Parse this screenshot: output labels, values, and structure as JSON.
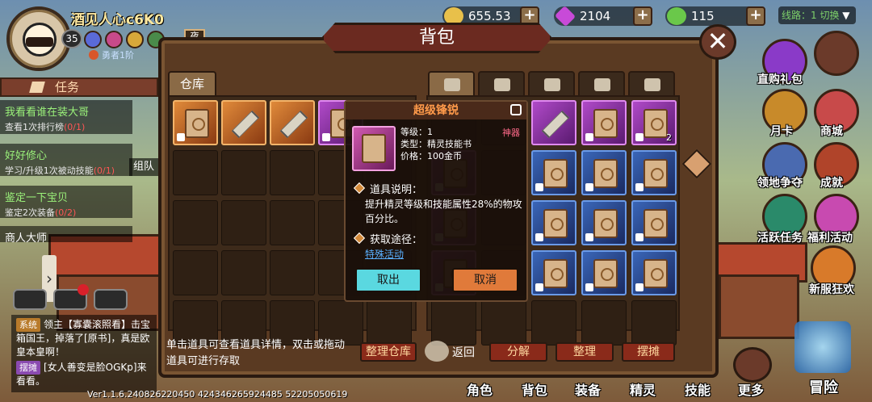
{
  "player": {
    "name": "酒见人心c6K0",
    "level": "35",
    "rank": "勇者1阶",
    "badge_label": "夜"
  },
  "resources": {
    "gold": "655.53万",
    "gems": "2104",
    "stamina": "115"
  },
  "line_select": "线路：1 切换",
  "tasks": {
    "header": "任务",
    "items": [
      {
        "title": "我看看谁在装大哥",
        "desc": "查看1次排行榜",
        "progress": "(0/1)"
      },
      {
        "title": "好好修心",
        "desc": "学习/升级1次被动技能",
        "progress": "(0/1)"
      },
      {
        "title": "鉴定一下宝贝",
        "desc": "鉴定2次装备",
        "progress": "(0/2)"
      },
      {
        "title": "商人大师",
        "desc": "",
        "progress": ""
      }
    ],
    "side_label": "组队"
  },
  "chat": [
    {
      "tag": "系统",
      "text": "领主【寡囊滚照看】击宝箱国王，掉落了[原书]，真是欧皇本皇啊！"
    },
    {
      "tag": "摆摊",
      "text": "[女人善变是脸OGKp]来看看。"
    }
  ],
  "bag": {
    "title": "背包",
    "close": "✕",
    "warehouse_tab": "仓库",
    "help_text": "单击道具可查看道具详情，双击或拖动道具可进行存取",
    "buttons": {
      "organize_warehouse": "整理仓库",
      "back": "返回",
      "decompose": "分解",
      "organize": "整理",
      "stall": "摆摊"
    },
    "item_counts": [
      "2"
    ]
  },
  "popup": {
    "title": "超级锋锐",
    "level": "等级：1",
    "type": "类型：精灵技能书",
    "price": "价格：100金币",
    "tag": "神器",
    "desc_title": "道具说明：",
    "desc": "提升精灵等级和技能属性28%的物攻百分比。",
    "source_title": "获取途径：",
    "source_link": "特殊活动",
    "take_out": "取出",
    "cancel": "取消"
  },
  "right_menu": [
    "直购礼包",
    "月卡",
    "商城",
    "领地争夺",
    "成就",
    "活跃任务",
    "福利活动",
    "新服狂欢"
  ],
  "bottom_nav": [
    "角色",
    "背包",
    "装备",
    "精灵",
    "技能",
    "更多",
    "冒险"
  ],
  "version": "Ver1.1.6.240826220450   424346265924485   52205050619",
  "colors": {
    "accent": "#8a2a1a",
    "cyan_button": "#5ad8e0",
    "orange_button": "#e07a3a"
  }
}
